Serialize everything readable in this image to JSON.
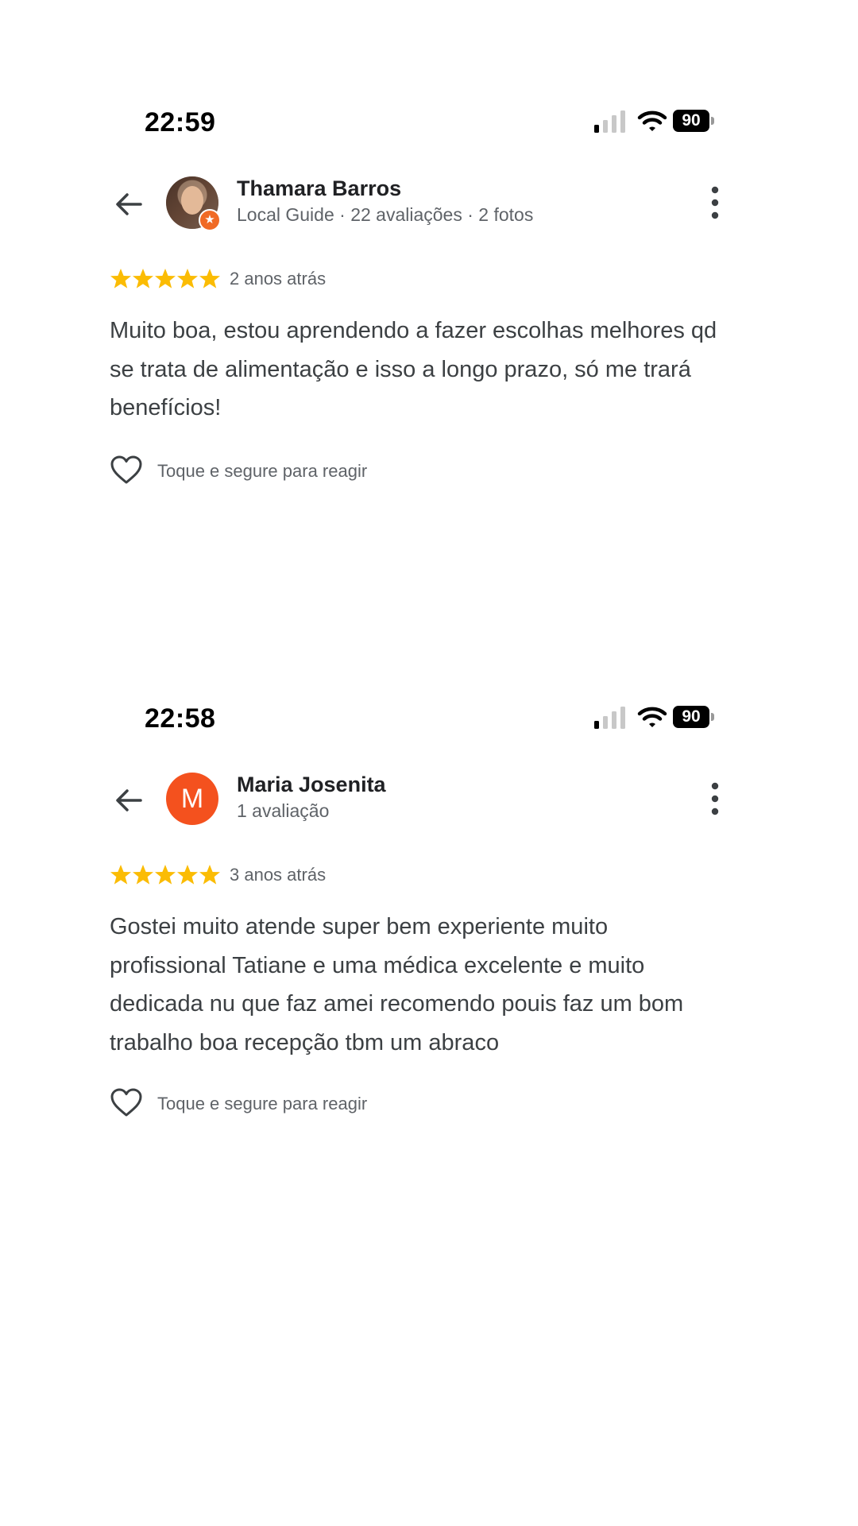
{
  "screens": [
    {
      "status": {
        "time": "22:59",
        "battery": "90"
      },
      "reviewer": {
        "name": "Thamara Barros",
        "meta": "Local Guide · 22 avaliações · 2 fotos",
        "avatar": "profile-photo",
        "badge": "★"
      },
      "review": {
        "stars": 5,
        "date": "2 anos atrás",
        "text": "Muito boa, estou aprendendo a fazer escolhas melhores qd se trata de alimentação e isso a longo prazo, só me trará benefícios!"
      },
      "react": {
        "label": "Toque e segure para reagir"
      }
    },
    {
      "status": {
        "time": "22:58",
        "battery": "90"
      },
      "reviewer": {
        "name": "Maria Josenita",
        "meta": "1 avaliação",
        "avatar_letter": "M",
        "avatar_color": "#f4511e"
      },
      "review": {
        "stars": 5,
        "date": "3 anos atrás",
        "text": "Gostei muito atende super bem experiente muito profissional Tatiane e uma médica excelente e muito dedicada nu que faz amei recomendo pouis faz um bom trabalho boa recepção tbm um abraco"
      },
      "react": {
        "label": "Toque e segure para reagir"
      }
    }
  ],
  "colors": {
    "star": "#fbbc04",
    "text_primary": "#202124",
    "text_secondary": "#5f6368",
    "accent_orange": "#f06a25"
  }
}
